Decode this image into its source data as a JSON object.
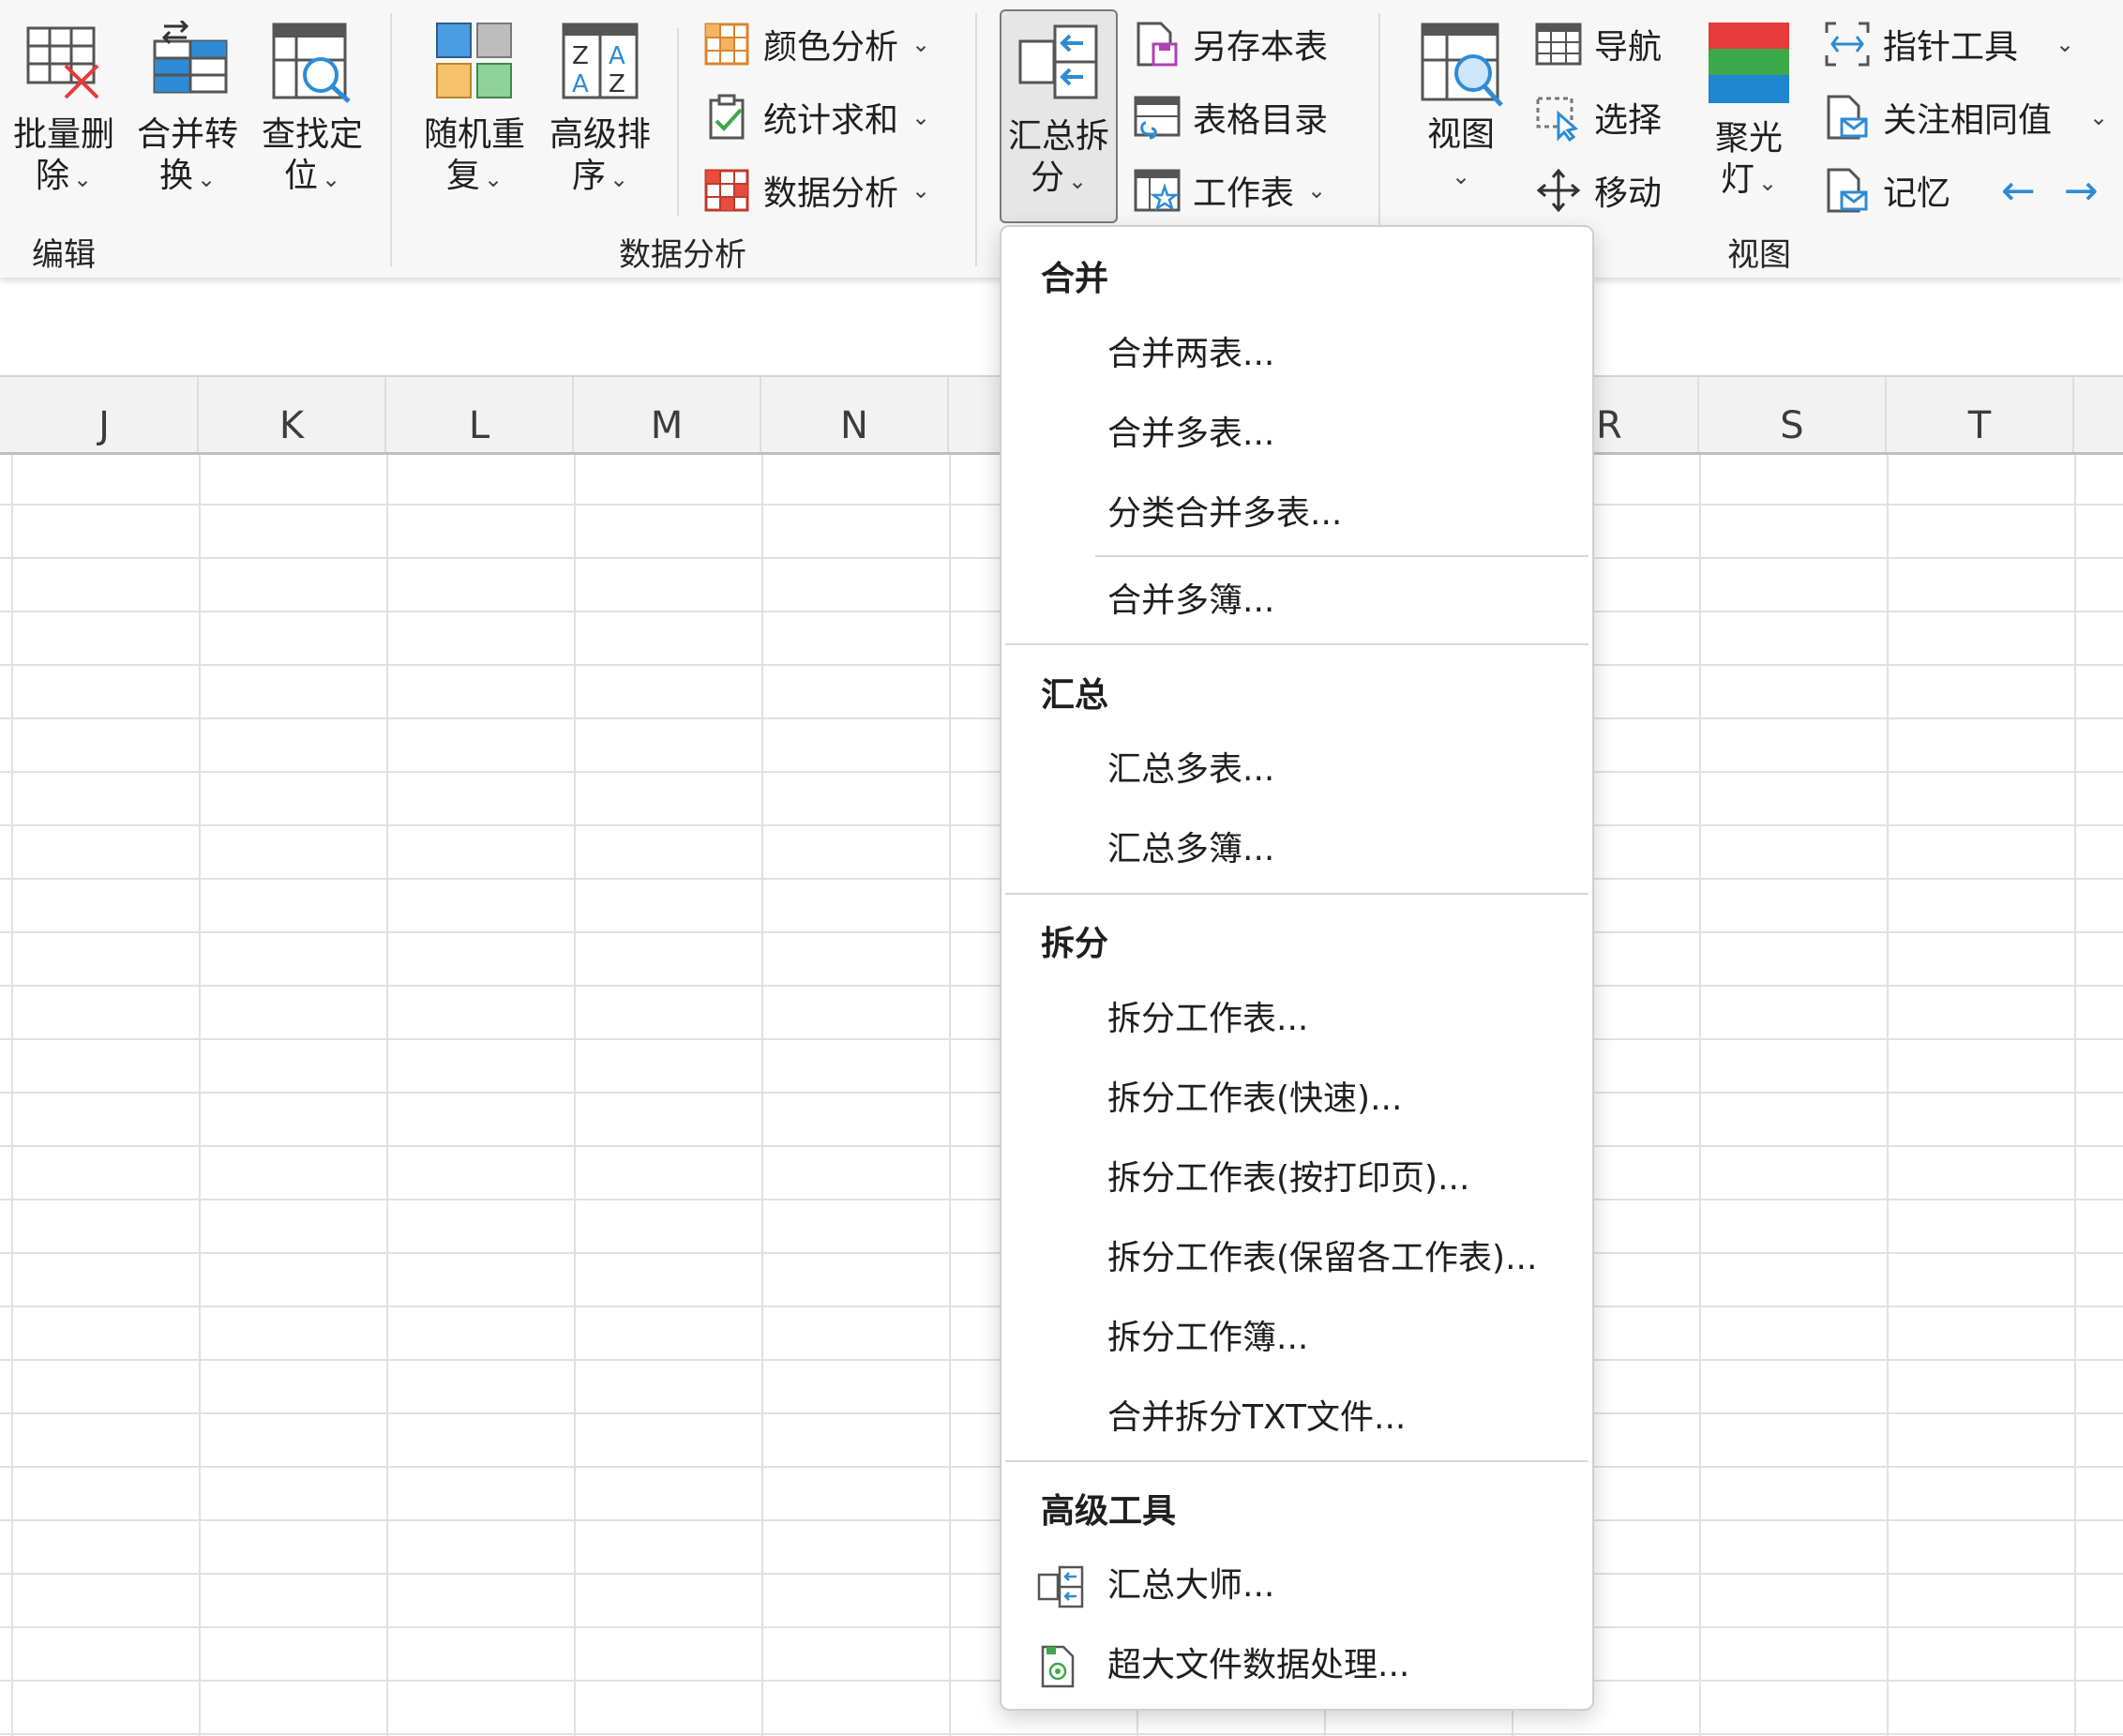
{
  "ribbon": {
    "groups": {
      "edit": "编辑",
      "data_analysis": "数据分析",
      "view": "视图"
    },
    "edit": {
      "batch_delete": [
        "批量删",
        "除"
      ],
      "merge_convert": [
        "合并转",
        "换"
      ],
      "find_locate": [
        "查找定",
        "位"
      ]
    },
    "data": {
      "random_repeat": [
        "随机重",
        "复"
      ],
      "advanced_sort": [
        "高级排",
        "序"
      ],
      "color_analysis": "颜色分析",
      "stat_sum": "统计求和",
      "data_analysis": "数据分析",
      "summary_split": [
        "汇总拆",
        "分"
      ],
      "save_this_sheet": "另存本表",
      "table_directory": "表格目录",
      "worksheet": "工作表"
    },
    "view": {
      "view": "视图",
      "navigate": "导航",
      "select": "选择",
      "move": "移动",
      "spotlight": [
        "聚光",
        "灯"
      ],
      "pointer_tool": "指针工具",
      "focus_same": "关注相同值",
      "memory": "记忆",
      "back_arrow": "←",
      "forward_arrow": "→"
    },
    "chevron": "⌄"
  },
  "columns": [
    "J",
    "K",
    "L",
    "M",
    "N",
    "R",
    "S",
    "T"
  ],
  "dropdown": {
    "sections": {
      "merge": "合并",
      "summary": "汇总",
      "split": "拆分",
      "advanced": "高级工具"
    },
    "merge_items": [
      "合并两表...",
      "合并多表...",
      "分类合并多表...",
      "合并多簿..."
    ],
    "summary_items": [
      "汇总多表...",
      "汇总多簿..."
    ],
    "split_items": [
      "拆分工作表...",
      "拆分工作表(快速)...",
      "拆分工作表(按打印页)...",
      "拆分工作表(保留各工作表)...",
      "拆分工作簿...",
      "合并拆分TXT文件..."
    ],
    "advanced_items": [
      "汇总大师...",
      "超大文件数据处理..."
    ]
  },
  "colors": {
    "accent_blue": "#2e8bd6",
    "red": "#e83a3a",
    "green": "#3da84a",
    "spotlight_blue": "#1f86d1"
  }
}
